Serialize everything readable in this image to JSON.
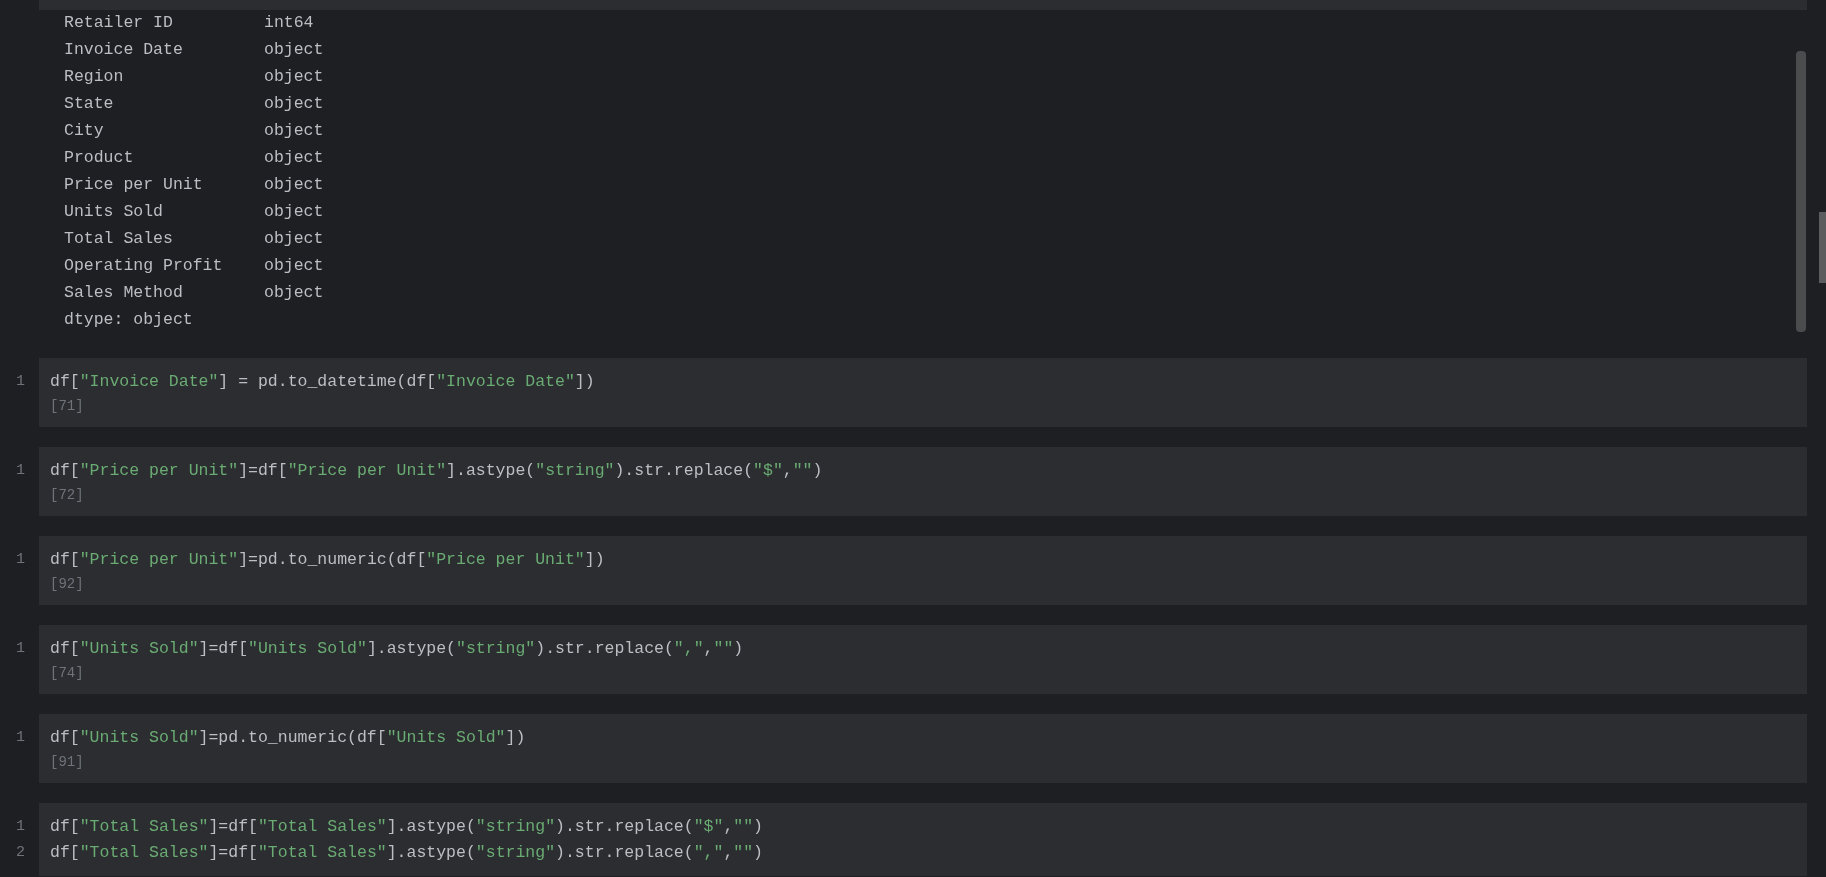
{
  "output": {
    "rows": [
      {
        "name": "Retailer ID",
        "dtype": "int64"
      },
      {
        "name": "Invoice Date",
        "dtype": "object"
      },
      {
        "name": "Region",
        "dtype": "object"
      },
      {
        "name": "State",
        "dtype": "object"
      },
      {
        "name": "City",
        "dtype": "object"
      },
      {
        "name": "Product",
        "dtype": "object"
      },
      {
        "name": "Price per Unit",
        "dtype": "object"
      },
      {
        "name": "Units Sold",
        "dtype": "object"
      },
      {
        "name": "Total Sales",
        "dtype": "object"
      },
      {
        "name": "Operating Profit",
        "dtype": "object"
      },
      {
        "name": "Sales Method",
        "dtype": "object"
      }
    ],
    "footer": "dtype: object"
  },
  "cells": [
    {
      "lines": [
        {
          "number": "1",
          "tokens": [
            {
              "kind": "plain",
              "text": "df["
            },
            {
              "kind": "string",
              "text": "\"Invoice Date\""
            },
            {
              "kind": "plain",
              "text": "] = pd.to_datetime(df["
            },
            {
              "kind": "string",
              "text": "\"Invoice Date\""
            },
            {
              "kind": "plain",
              "text": "])"
            }
          ]
        }
      ],
      "count": "[71]"
    },
    {
      "lines": [
        {
          "number": "1",
          "tokens": [
            {
              "kind": "plain",
              "text": "df["
            },
            {
              "kind": "string",
              "text": "\"Price per Unit\""
            },
            {
              "kind": "plain",
              "text": "]=df["
            },
            {
              "kind": "string",
              "text": "\"Price per Unit\""
            },
            {
              "kind": "plain",
              "text": "].astype("
            },
            {
              "kind": "string",
              "text": "\"string\""
            },
            {
              "kind": "plain",
              "text": ").str.replace("
            },
            {
              "kind": "string",
              "text": "\"$\""
            },
            {
              "kind": "plain",
              "text": ","
            },
            {
              "kind": "string",
              "text": "\"\""
            },
            {
              "kind": "plain",
              "text": ")"
            }
          ]
        }
      ],
      "count": "[72]"
    },
    {
      "lines": [
        {
          "number": "1",
          "tokens": [
            {
              "kind": "plain",
              "text": "df["
            },
            {
              "kind": "string",
              "text": "\"Price per Unit\""
            },
            {
              "kind": "plain",
              "text": "]=pd.to_numeric(df["
            },
            {
              "kind": "string",
              "text": "\"Price per Unit\""
            },
            {
              "kind": "plain",
              "text": "])"
            }
          ]
        }
      ],
      "count": "[92]"
    },
    {
      "lines": [
        {
          "number": "1",
          "tokens": [
            {
              "kind": "plain",
              "text": "df["
            },
            {
              "kind": "string",
              "text": "\"Units Sold\""
            },
            {
              "kind": "plain",
              "text": "]=df["
            },
            {
              "kind": "string",
              "text": "\"Units Sold\""
            },
            {
              "kind": "plain",
              "text": "].astype("
            },
            {
              "kind": "string",
              "text": "\"string\""
            },
            {
              "kind": "plain",
              "text": ").str.replace("
            },
            {
              "kind": "string",
              "text": "\",\""
            },
            {
              "kind": "plain",
              "text": ","
            },
            {
              "kind": "string",
              "text": "\"\""
            },
            {
              "kind": "plain",
              "text": ")"
            }
          ]
        }
      ],
      "count": "[74]"
    },
    {
      "lines": [
        {
          "number": "1",
          "tokens": [
            {
              "kind": "plain",
              "text": "df["
            },
            {
              "kind": "string",
              "text": "\"Units Sold\""
            },
            {
              "kind": "plain",
              "text": "]=pd.to_numeric(df["
            },
            {
              "kind": "string",
              "text": "\"Units Sold\""
            },
            {
              "kind": "plain",
              "text": "])"
            }
          ]
        }
      ],
      "count": "[91]"
    },
    {
      "lines": [
        {
          "number": "1",
          "tokens": [
            {
              "kind": "plain",
              "text": "df["
            },
            {
              "kind": "string",
              "text": "\"Total Sales\""
            },
            {
              "kind": "plain",
              "text": "]=df["
            },
            {
              "kind": "string",
              "text": "\"Total Sales\""
            },
            {
              "kind": "plain",
              "text": "].astype("
            },
            {
              "kind": "string",
              "text": "\"string\""
            },
            {
              "kind": "plain",
              "text": ").str.replace("
            },
            {
              "kind": "string",
              "text": "\"$\""
            },
            {
              "kind": "plain",
              "text": ","
            },
            {
              "kind": "string",
              "text": "\"\""
            },
            {
              "kind": "plain",
              "text": ")"
            }
          ]
        },
        {
          "number": "2",
          "tokens": [
            {
              "kind": "plain",
              "text": "df["
            },
            {
              "kind": "string",
              "text": "\"Total Sales\""
            },
            {
              "kind": "plain",
              "text": "]=df["
            },
            {
              "kind": "string",
              "text": "\"Total Sales\""
            },
            {
              "kind": "plain",
              "text": "].astype("
            },
            {
              "kind": "string",
              "text": "\"string\""
            },
            {
              "kind": "plain",
              "text": ").str.replace("
            },
            {
              "kind": "string",
              "text": "\",\""
            },
            {
              "kind": "plain",
              "text": ","
            },
            {
              "kind": "string",
              "text": "\"\""
            },
            {
              "kind": "plain",
              "text": ")"
            }
          ]
        }
      ]
    }
  ]
}
